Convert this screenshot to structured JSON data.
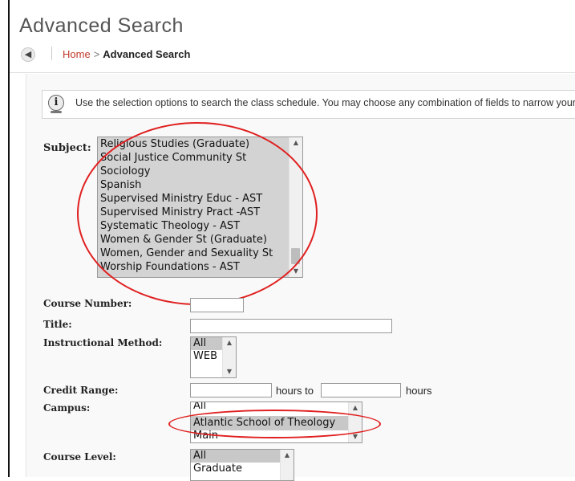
{
  "page": {
    "title": "Advanced Search"
  },
  "breadcrumb": {
    "home": "Home",
    "separator": ">",
    "current": "Advanced Search"
  },
  "info": {
    "text": "Use the selection options to search the class schedule. You may choose any combination of fields to narrow your search"
  },
  "subject": {
    "label": "Subject:",
    "options": [
      "Religious Studies (Graduate)",
      "Social Justice Community St",
      "Sociology",
      "Spanish",
      "Supervised Ministry Educ - AST",
      "Supervised Ministry Pract -AST",
      "Systematic Theology - AST",
      "Women & Gender St (Graduate)",
      "Women, Gender and Sexuality St",
      "Worship Foundations - AST"
    ]
  },
  "course_number": {
    "label": "Course Number:",
    "value": ""
  },
  "title_field": {
    "label": "Title:",
    "value": ""
  },
  "instructional_method": {
    "label": "Instructional Method:",
    "options": [
      "All",
      "WEB"
    ]
  },
  "credit_range": {
    "label": "Credit Range:",
    "from": "",
    "to": "",
    "mid_text": "hours to",
    "end_text": "hours"
  },
  "campus": {
    "label": "Campus:",
    "options": [
      "All",
      "Atlantic School of Theology",
      "Main"
    ],
    "selected": "Atlantic School of Theology"
  },
  "course_level": {
    "label": "Course Level:",
    "options": [
      "All",
      "Graduate"
    ]
  },
  "colors": {
    "accent_link": "#c0392b",
    "annotation": "#e02020",
    "selection_bg": "#c8c8c8"
  }
}
